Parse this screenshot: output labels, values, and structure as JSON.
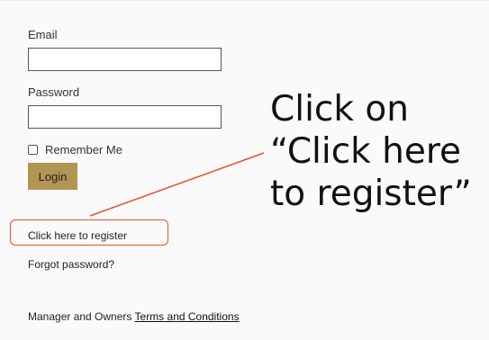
{
  "form": {
    "email_label": "Email",
    "email_value": "",
    "password_label": "Password",
    "password_value": "",
    "remember_label": "Remember Me",
    "remember_checked": false,
    "login_label": "Login"
  },
  "links": {
    "register": "Click here to register",
    "forgot": "Forgot password?"
  },
  "footer": {
    "prefix": "Manager and Owners ",
    "terms_link": "Terms and Conditions"
  },
  "annotation": {
    "line1": "Click on",
    "line2": "“Click here",
    "line3": "to register”"
  },
  "colors": {
    "accent_button": "#b39553",
    "highlight": "#e8512b"
  }
}
